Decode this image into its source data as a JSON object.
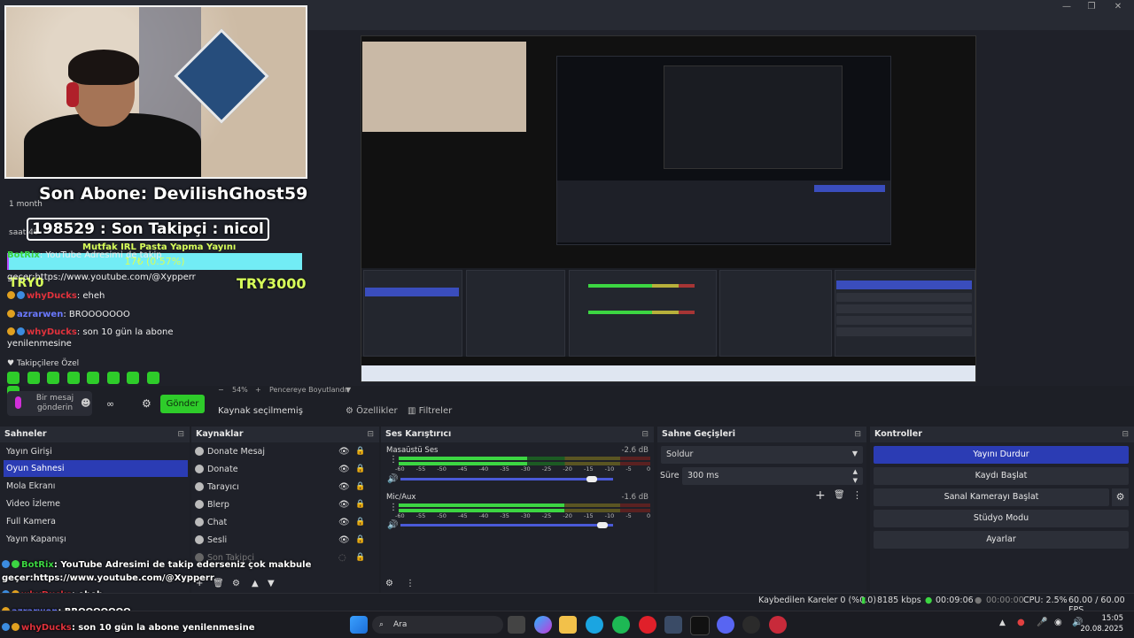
{
  "window": {
    "minimize": "—",
    "maximize": "❐",
    "close": "✕"
  },
  "overlay": {
    "son_abone": "Son Abone: DevilishGhost59",
    "son_takipci": "198529 : Son Takipçi : nicol",
    "goal_title": "Mutfak IRL Pasta Yapma Yayını",
    "goal_progress_text": "17₺ (0.57%)",
    "goal_fraction": 0.0057,
    "try_left": "TRY0",
    "try_right": "TRY3000",
    "ghost_texts": [
      "1 month",
      "saat 40"
    ]
  },
  "chat_panel": {
    "messages": [
      {
        "user": "BotRix",
        "text": ": YouTube Adresimi de takip",
        "color": "#3cd642"
      },
      {
        "user": "",
        "text": "geçer:https://www.youtube.com/@Xypperr",
        "color": "#fff"
      },
      {
        "user": "whyDucks",
        "text": ": eheh",
        "color": "#e0323c"
      },
      {
        "user": "azrarwen",
        "text": ": BROOOOOOO",
        "color": "#6a79ff"
      },
      {
        "user": "whyDucks",
        "text": ": son 10 gün la abone",
        "color": "#e0323c"
      },
      {
        "user": "",
        "text": "yenilenmesine",
        "color": "#fff"
      }
    ],
    "followers_only": "Takipçilere Özel",
    "input_placeholder": "Bir mesaj gönderin",
    "send_label": "Gönder"
  },
  "preview_bar": {
    "zoom": "54%",
    "zoom_minus": "−",
    "zoom_plus": "+",
    "fit_label": "Pencereye Boyutlandır"
  },
  "context_bar": {
    "no_source": "Kaynak seçilmemiş",
    "properties": "Özellikler",
    "filters": "Filtreler"
  },
  "scenes": {
    "title": "Sahneler",
    "items": [
      "Yayın Girişi",
      "Oyun Sahnesi",
      "Mola Ekranı",
      "Video İzleme",
      "Full Kamera",
      "Yayın Kapanışı"
    ],
    "active_index": 1
  },
  "sources": {
    "title": "Kaynaklar",
    "items": [
      "Donate Mesaj",
      "Donate",
      "Tarayıcı",
      "Blerp",
      "Chat",
      "Sesli",
      "Son Takipçi"
    ]
  },
  "mixer": {
    "title": "Ses Karıştırıcı",
    "channels": [
      {
        "name": "Masaüstü Ses",
        "db": "-2.6 dB",
        "level": 0.51,
        "volume": 0.9
      },
      {
        "name": "Mic/Aux",
        "db": "-1.6 dB",
        "level": 0.66,
        "volume": 0.95
      }
    ],
    "scale": [
      "-60",
      "-55",
      "-50",
      "-45",
      "-40",
      "-35",
      "-30",
      "-25",
      "-20",
      "-15",
      "-10",
      "-5",
      "0"
    ]
  },
  "transitions": {
    "title": "Sahne Geçişleri",
    "selected": "Soldur",
    "duration_label": "Süre",
    "duration_value": "300 ms"
  },
  "controls": {
    "title": "Kontroller",
    "stop_stream": "Yayını Durdur",
    "start_recording": "Kaydı Başlat",
    "start_vcam": "Sanal Kamerayı Başlat",
    "studio_mode": "Stüdyo Modu",
    "settings": "Ayarlar"
  },
  "overlay_chat_bottom": [
    {
      "user": "BotRix",
      "text": ": YouTube Adresimi de takip ederseniz çok makbule",
      "color": "#3cd642"
    },
    {
      "user": "",
      "text": "geçer:https://www.youtube.com/@Xypperr",
      "color": "#fff"
    },
    {
      "user": "whyDucks",
      "text": ": eheh",
      "color": "#e0323c"
    },
    {
      "user": "azrarwen",
      "text": ": BROOOOOOO",
      "color": "#6a79ff"
    },
    {
      "user": "whyDucks",
      "text": ": son 10 gün la abone yenilenmesine",
      "color": "#e0323c"
    }
  ],
  "statusbar": {
    "dropped": "Kaybedilen Kareler 0 (%0.0)",
    "kbps": "8185 kbps",
    "stream_time": "00:09:06",
    "rec_time": "00:00:00",
    "cpu": "CPU: 2.5%",
    "fps": "60.00 / 60.00 FPS"
  },
  "taskbar": {
    "search": "Ara",
    "time": "15:05",
    "date": "20.08.2025"
  },
  "colors": {
    "accent": "#2b3cb4",
    "send": "#2ecc2a",
    "goal": "#72ecf5"
  }
}
